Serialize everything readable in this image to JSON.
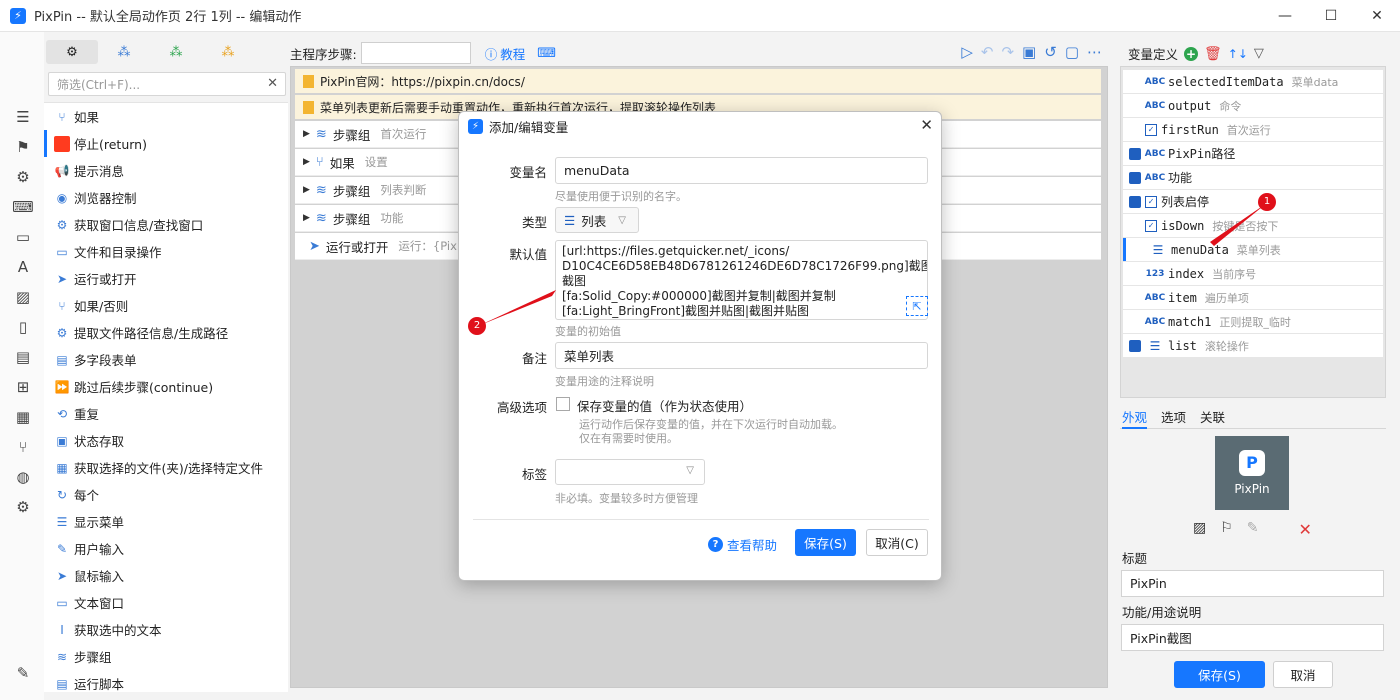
{
  "window": {
    "title": "PixPin -- 默认全局动作页 2行 1列 -- 编辑动作",
    "minimize": "—",
    "maximize": "☐",
    "close": "✕"
  },
  "left_panel": {
    "filter_placeholder": "筛选(Ctrl+F)...",
    "actions": [
      {
        "label": "如果",
        "icon": "branch-icon"
      },
      {
        "label": "停止(return)",
        "icon": "stop-icon"
      },
      {
        "label": "提示消息",
        "icon": "megaphone-icon"
      },
      {
        "label": "浏览器控制",
        "icon": "chrome-icon"
      },
      {
        "label": "获取窗口信息/查找窗口",
        "icon": "gear-icon"
      },
      {
        "label": "文件和目录操作",
        "icon": "folder-icon"
      },
      {
        "label": "运行或打开",
        "icon": "send-icon"
      },
      {
        "label": "如果/否则",
        "icon": "branch-icon"
      },
      {
        "label": "提取文件路径信息/生成路径",
        "icon": "gear-icon"
      },
      {
        "label": "多字段表单",
        "icon": "form-icon"
      },
      {
        "label": "跳过后续步骤(continue)",
        "icon": "skip-icon"
      },
      {
        "label": "重复",
        "icon": "repeat-icon"
      },
      {
        "label": "状态存取",
        "icon": "state-icon"
      },
      {
        "label": "获取选择的文件(夹)/选择特定文件",
        "icon": "file-select-icon"
      },
      {
        "label": "每个",
        "icon": "loop-icon"
      },
      {
        "label": "显示菜单",
        "icon": "menu-icon"
      },
      {
        "label": "用户输入",
        "icon": "user-input-icon"
      },
      {
        "label": "鼠标输入",
        "icon": "cursor-icon"
      },
      {
        "label": "文本窗口",
        "icon": "text-window-icon"
      },
      {
        "label": "获取选中的文本",
        "icon": "text-cursor-icon"
      },
      {
        "label": "步骤组",
        "icon": "layers-icon"
      },
      {
        "label": "运行脚本",
        "icon": "script-icon"
      }
    ]
  },
  "main": {
    "toolbar_label": "主程序步骤:",
    "tutorial": "教程",
    "notes": [
      "PixPin官网：https://pixpin.cn/docs/",
      "菜单列表更新后需要手动重置动作，重新执行首次运行，提取滚轮操作列表"
    ],
    "steps": [
      {
        "label": "步骤组",
        "desc": "首次运行",
        "icon": "layers-icon",
        "expand": "▶"
      },
      {
        "label": "如果",
        "desc": "设置",
        "icon": "branch-icon",
        "expand": "▶"
      },
      {
        "label": "步骤组",
        "desc": "列表判断",
        "icon": "layers-icon",
        "expand": "▶"
      },
      {
        "label": "步骤组",
        "desc": "功能",
        "icon": "layers-icon",
        "expand": "▶"
      },
      {
        "label": "运行或打开",
        "desc": "运行：{PixPin",
        "icon": "send-icon",
        "expand": ""
      }
    ]
  },
  "right_panel": {
    "header": "变量定义",
    "variables": [
      {
        "name": "selectedItemData",
        "desc": "菜单data",
        "type": "ABC",
        "saved": false,
        "checked": null,
        "selected": false
      },
      {
        "name": "output",
        "desc": "命令",
        "type": "ABC",
        "saved": false,
        "checked": null,
        "selected": false
      },
      {
        "name": "firstRun",
        "desc": "首次运行",
        "type": "check",
        "saved": false,
        "checked": true,
        "selected": false
      },
      {
        "name": "PixPin路径",
        "desc": "",
        "type": "ABC",
        "saved": true,
        "checked": null,
        "selected": false
      },
      {
        "name": "功能",
        "desc": "",
        "type": "ABC",
        "saved": true,
        "checked": null,
        "selected": false
      },
      {
        "name": "列表启停",
        "desc": "",
        "type": "check",
        "saved": true,
        "checked": true,
        "selected": false
      },
      {
        "name": "isDown",
        "desc": "按键是否按下",
        "type": "check",
        "saved": false,
        "checked": true,
        "selected": false
      },
      {
        "name": "menuData",
        "desc": "菜单列表",
        "type": "list",
        "saved": false,
        "checked": null,
        "selected": true
      },
      {
        "name": "index",
        "desc": "当前序号",
        "type": "123",
        "saved": false,
        "checked": null,
        "selected": false
      },
      {
        "name": "item",
        "desc": "遍历单项",
        "type": "ABC",
        "saved": false,
        "checked": null,
        "selected": false
      },
      {
        "name": "match1",
        "desc": "正则提取_临时",
        "type": "ABC",
        "saved": false,
        "checked": null,
        "selected": false
      },
      {
        "name": "list",
        "desc": "滚轮操作",
        "type": "list",
        "saved": true,
        "checked": null,
        "selected": false
      }
    ],
    "tabs": [
      "外观",
      "选项",
      "关联"
    ],
    "preview_text": "PixPin",
    "preview_logo": "P",
    "title_label": "标题",
    "title_value": "PixPin",
    "desc_label": "功能/用途说明",
    "desc_value": "PixPin截图",
    "save_btn": "保存(S)",
    "cancel_btn": "取消"
  },
  "dialog": {
    "title": "添加/编辑变量",
    "name_label": "变量名",
    "name_value": "menuData",
    "name_hint": "尽量使用便于识别的名字。",
    "type_label": "类型",
    "type_value": "列表",
    "default_label": "默认值",
    "default_value": "[url:https://files.getquicker.net/_icons/\nD10C4CE6D58EB48D6781261246DE6D78C1726F99.png]截图|\n截图\n[fa:Solid_Copy:#000000]截图并复制|截图并复制\n[fa:Light_BringFront]截图并贴图|截图并贴图",
    "default_hint": "变量的初始值",
    "note_label": "备注",
    "note_value": "菜单列表",
    "note_hint": "变量用途的注释说明",
    "advanced_label": "高级选项",
    "save_state_label": "保存变量的值（作为状态使用）",
    "save_state_hint1": "运行动作后保存变量的值，并在下次运行时自动加载。",
    "save_state_hint2": "仅在有需要时使用。",
    "tag_label": "标签",
    "tag_hint": "非必填。变量较多时方便管理",
    "help": "查看帮助",
    "save": "保存(S)",
    "cancel": "取消(C)"
  },
  "annotations": [
    "1",
    "2"
  ],
  "colors": {
    "accent": "#1677ff",
    "annotation": "#e0101a",
    "note_bg": "#fbf3dc"
  }
}
